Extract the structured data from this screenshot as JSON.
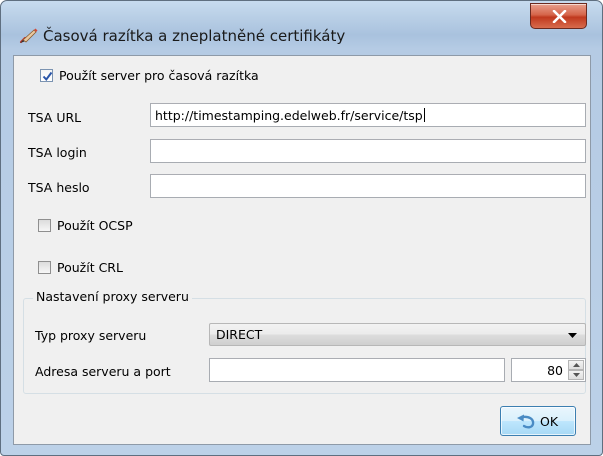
{
  "window": {
    "title": "Časová razítka a zneplatněné certifikáty",
    "close_icon": "close-x-icon",
    "title_icon": "certificate-pen-icon"
  },
  "tsa": {
    "use_server_label": "Použít server pro časová razítka",
    "use_server_checked": true,
    "url_label": "TSA URL",
    "url_value": "http://timestamping.edelweb.fr/service/tsp",
    "login_label": "TSA login",
    "login_value": "",
    "password_label": "TSA heslo",
    "password_value": ""
  },
  "revocation": {
    "ocsp_label": "Použít OCSP",
    "ocsp_checked": false,
    "crl_label": "Použít CRL",
    "crl_checked": false
  },
  "proxy": {
    "group_title": "Nastavení proxy serveru",
    "type_label": "Typ proxy serveru",
    "type_selected": "DIRECT",
    "address_label": "Adresa serveru a port",
    "address_value": "",
    "port_value": "80"
  },
  "buttons": {
    "ok_label": "OK",
    "ok_icon": "undo-arrow-icon"
  },
  "colors": {
    "titlebar": "#b9cfe6",
    "close_button": "#c7432a",
    "ok_button": "#bee6fd",
    "client_background": "#f0f0f0"
  }
}
